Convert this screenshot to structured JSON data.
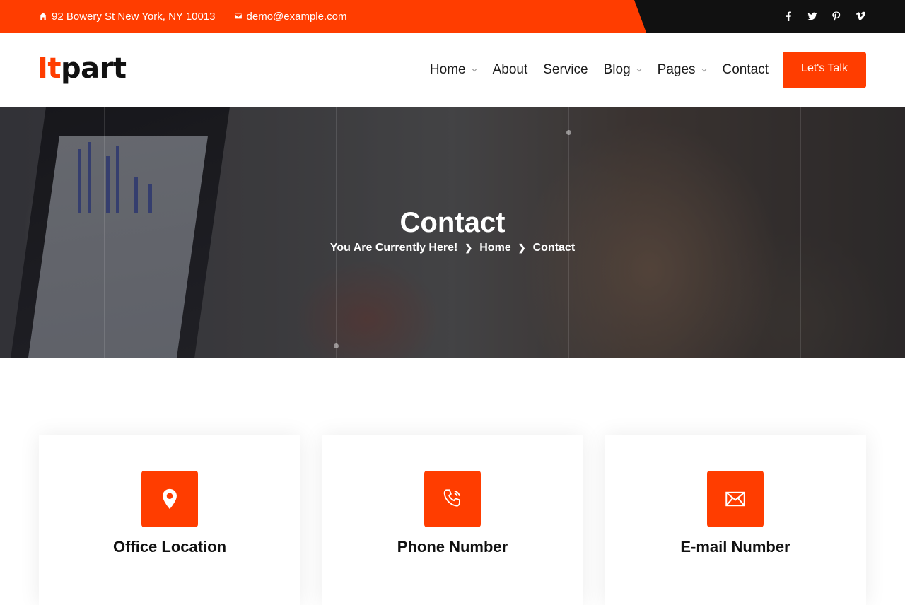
{
  "topbar": {
    "address": "92 Bowery St New York, NY 10013",
    "email": "demo@example.com",
    "social": [
      "facebook-icon",
      "twitter-icon",
      "pinterest-icon",
      "vimeo-icon"
    ]
  },
  "brand": {
    "logo_part1": "It",
    "logo_part2": "part"
  },
  "nav": {
    "items": [
      {
        "label": "Home",
        "dropdown": true
      },
      {
        "label": "About",
        "dropdown": false
      },
      {
        "label": "Service",
        "dropdown": false
      },
      {
        "label": "Blog",
        "dropdown": true
      },
      {
        "label": "Pages",
        "dropdown": true
      },
      {
        "label": "Contact",
        "dropdown": false
      }
    ],
    "cta_label": "Let's Talk"
  },
  "hero": {
    "title": "Contact",
    "breadcrumb": {
      "lead": "You Are Currently Here!",
      "home": "Home",
      "current": "Contact"
    }
  },
  "cards": [
    {
      "title": "Office Location",
      "icon": "map-pin-icon"
    },
    {
      "title": "Phone Number",
      "icon": "phone-icon"
    },
    {
      "title": "E-mail Number",
      "icon": "envelope-icon"
    }
  ],
  "colors": {
    "accent": "#ff3d00",
    "dark": "#111111"
  }
}
